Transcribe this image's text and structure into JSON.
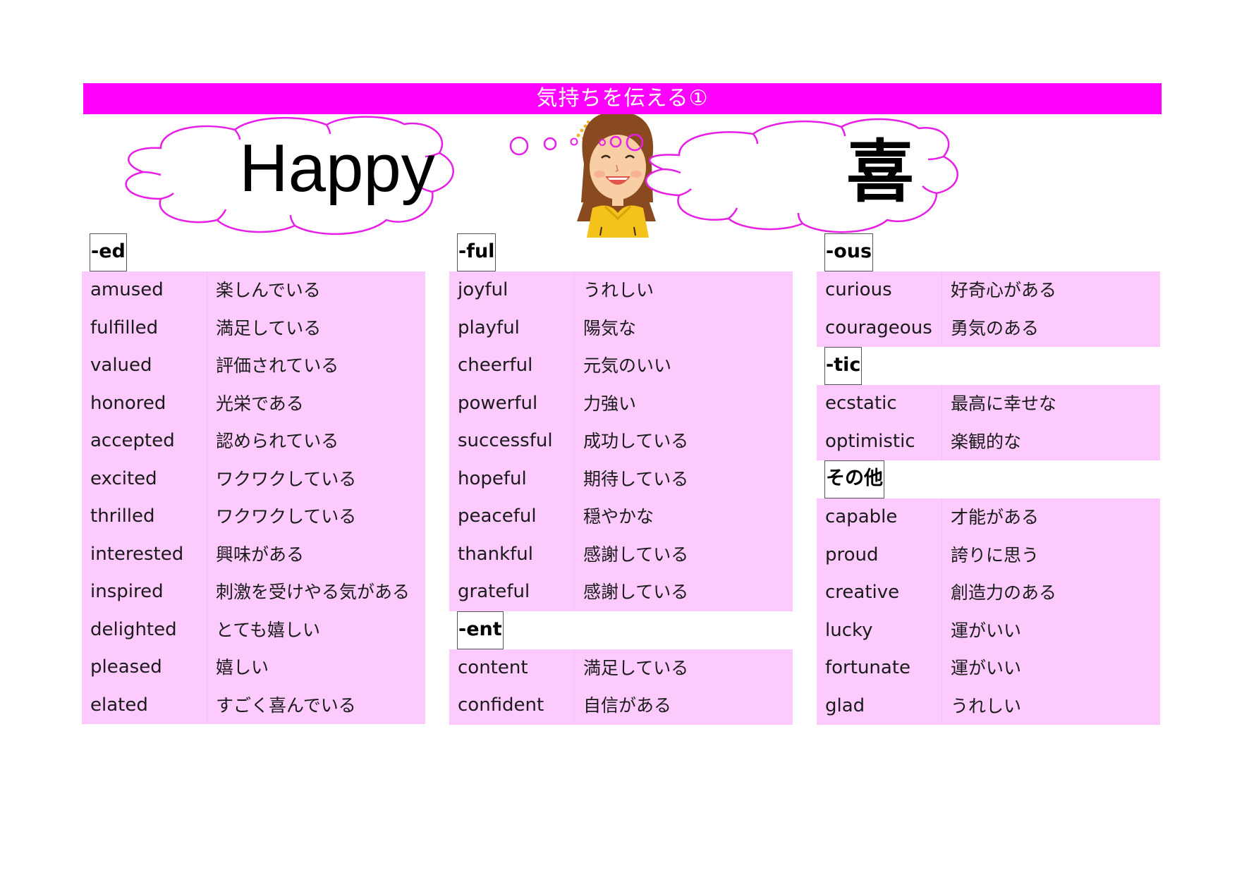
{
  "header": {
    "title": "気持ちを伝える①"
  },
  "hero": {
    "english_word": "Happy",
    "kanji": "喜",
    "illustration": "smiling-girl-illustration",
    "accent_color": "#ff00ff",
    "cloud_outline_color": "#e61ee6"
  },
  "columns": [
    {
      "groups": [
        {
          "suffix": "-ed",
          "rows": [
            {
              "en": "amused",
              "jp": "楽しんでいる"
            },
            {
              "en": "fulfilled",
              "jp": "満足している"
            },
            {
              "en": "valued",
              "jp": "評価されている"
            },
            {
              "en": "honored",
              "jp": "光栄である"
            },
            {
              "en": "accepted",
              "jp": "認められている"
            },
            {
              "en": "excited",
              "jp": "ワクワクしている"
            },
            {
              "en": "thrilled",
              "jp": "ワクワクしている"
            },
            {
              "en": "interested",
              "jp": "興味がある"
            },
            {
              "en": "inspired",
              "jp": "刺激を受けやる気がある"
            },
            {
              "en": "delighted",
              "jp": "とても嬉しい"
            },
            {
              "en": "pleased",
              "jp": "嬉しい"
            },
            {
              "en": "elated",
              "jp": "すごく喜んでいる"
            }
          ]
        }
      ]
    },
    {
      "groups": [
        {
          "suffix": "-ful",
          "rows": [
            {
              "en": "joyful",
              "jp": "うれしい"
            },
            {
              "en": "playful",
              "jp": "陽気な"
            },
            {
              "en": "cheerful",
              "jp": "元気のいい"
            },
            {
              "en": "powerful",
              "jp": "力強い"
            },
            {
              "en": "successful",
              "jp": "成功している"
            },
            {
              "en": "hopeful",
              "jp": "期待している"
            },
            {
              "en": "peaceful",
              "jp": "穏やかな"
            },
            {
              "en": "thankful",
              "jp": "感謝している"
            },
            {
              "en": "grateful",
              "jp": "感謝している"
            }
          ]
        },
        {
          "suffix": "-ent",
          "rows": [
            {
              "en": "content",
              "jp": "満足している"
            },
            {
              "en": "confident",
              "jp": "自信がある"
            }
          ]
        }
      ]
    },
    {
      "groups": [
        {
          "suffix": "-ous",
          "rows": [
            {
              "en": "curious",
              "jp": "好奇心がある"
            },
            {
              "en": "courageous",
              "jp": "勇気のある"
            }
          ]
        },
        {
          "suffix": "-tic",
          "rows": [
            {
              "en": "ecstatic",
              "jp": "最高に幸せな"
            },
            {
              "en": "optimistic",
              "jp": "楽観的な"
            }
          ]
        },
        {
          "suffix": "その他",
          "rows": [
            {
              "en": "capable",
              "jp": "才能がある"
            },
            {
              "en": "proud",
              "jp": "誇りに思う"
            },
            {
              "en": "creative",
              "jp": "創造力のある"
            },
            {
              "en": "lucky",
              "jp": "運がいい"
            },
            {
              "en": "fortunate",
              "jp": "運がいい"
            },
            {
              "en": "glad",
              "jp": "うれしい"
            }
          ]
        }
      ]
    }
  ]
}
